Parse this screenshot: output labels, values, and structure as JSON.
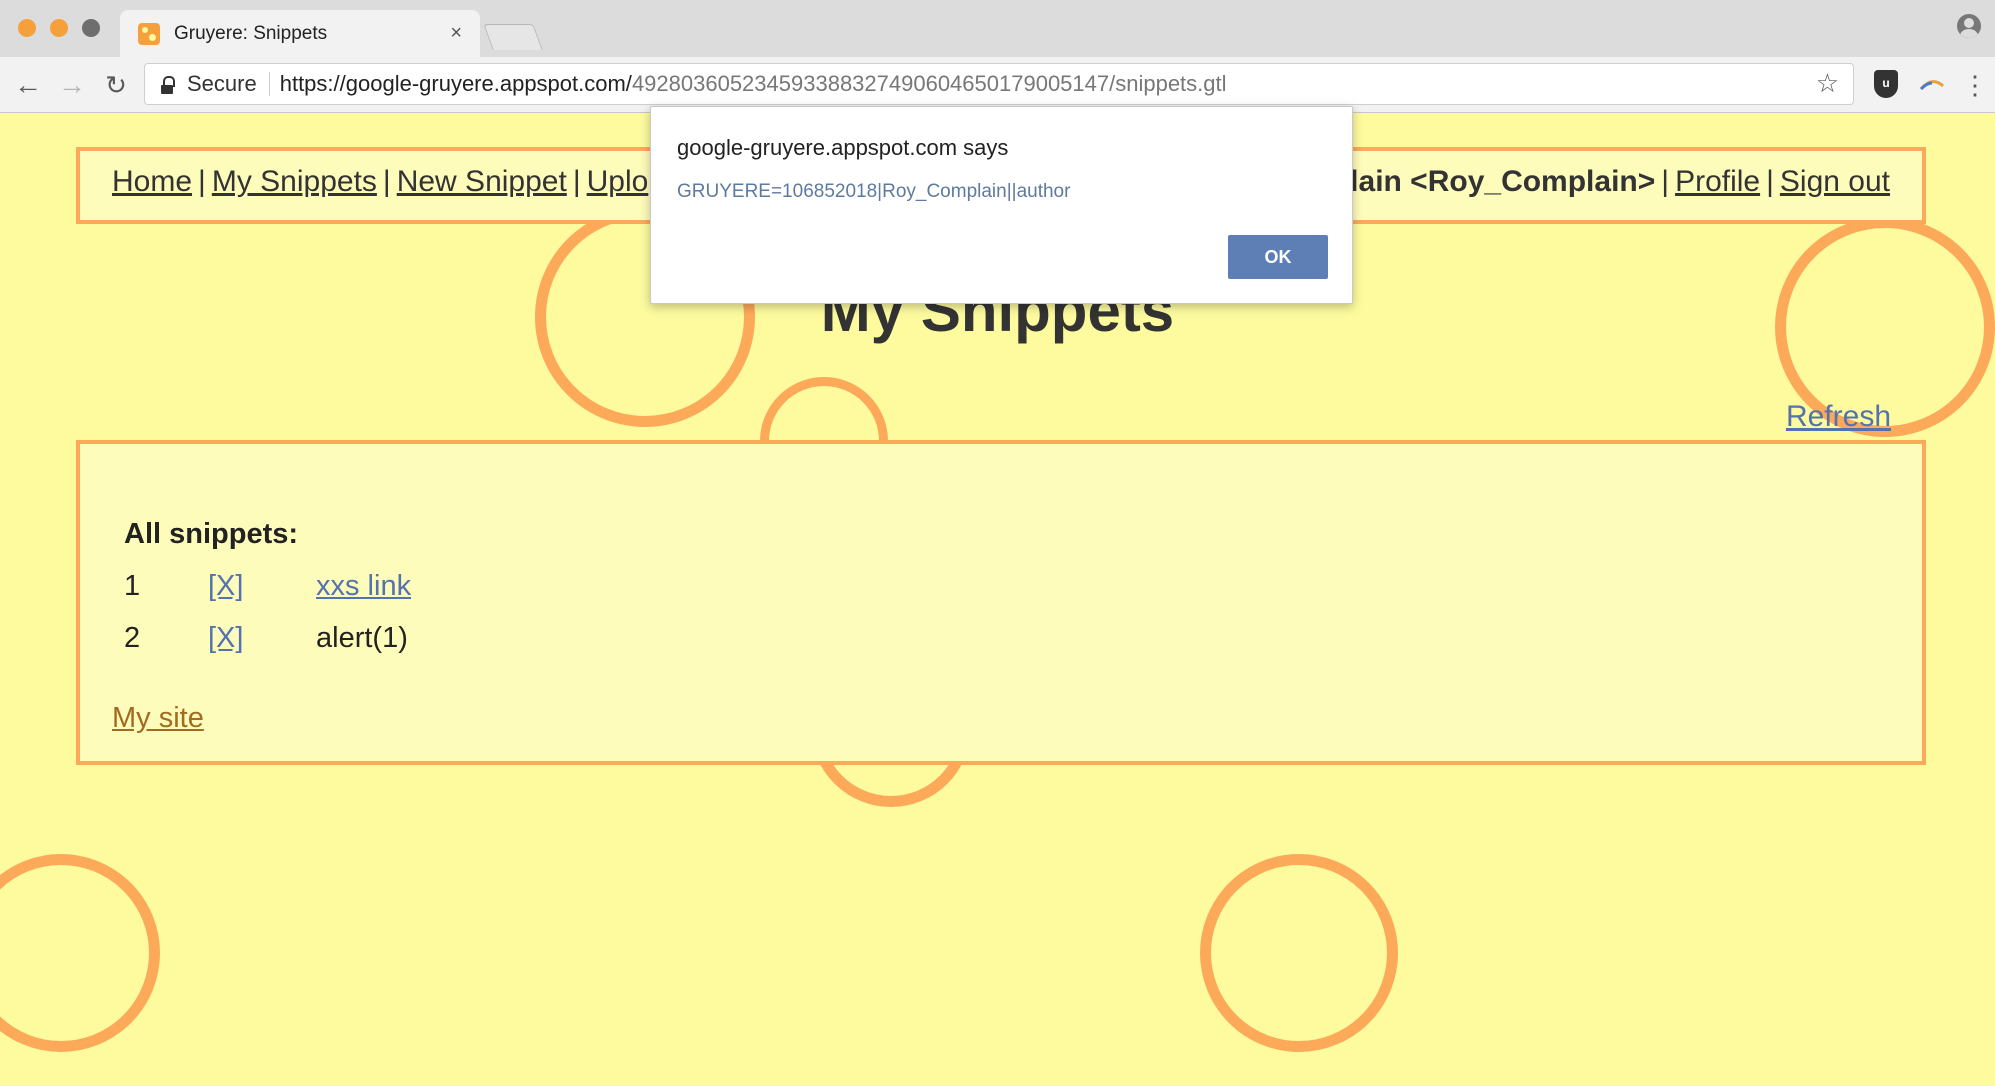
{
  "browser": {
    "tab_title": "Gruyere: Snippets",
    "tab_close": "×",
    "secure_label": "Secure",
    "url_host": "https://google-gruyere.appspot.com/",
    "url_path": "492803605234593388327490604650179005147/snippets.gtl",
    "star_glyph": "☆",
    "menu_glyph": "⋮",
    "back_glyph": "←",
    "forward_glyph": "→",
    "reload_glyph": "↻"
  },
  "menubar": {
    "left": [
      {
        "label": "Home"
      },
      {
        "label": "My Snippets"
      },
      {
        "label": "New Snippet"
      },
      {
        "label": "Uplo"
      }
    ],
    "user_fragment": "plain <Roy_Complain>",
    "right": [
      {
        "label": "Profile"
      },
      {
        "label": "Sign out"
      }
    ],
    "separator": "|"
  },
  "page": {
    "title": "My Snippets",
    "refresh_label": "Refresh",
    "heading": "All snippets:",
    "snippets": [
      {
        "number": "1",
        "delete_label": "[X]",
        "content": "xxs link",
        "is_link": true
      },
      {
        "number": "2",
        "delete_label": "[X]",
        "content": "alert(1)",
        "is_link": false
      }
    ],
    "my_site_label": "My site"
  },
  "dialog": {
    "origin": "google-gruyere.appspot.com says",
    "message": "GRUYERE=106852018|Roy_Complain||author",
    "ok_label": "OK"
  },
  "colors": {
    "page_background": "#fdfb9e",
    "accent_orange": "#fda95a",
    "link_blue": "#5472ad",
    "ok_button": "#5d7fb5"
  },
  "icons": [
    "lock-icon",
    "star-icon",
    "ublock-icon",
    "menu-icon",
    "profile-icon",
    "gruyere-favicon"
  ]
}
